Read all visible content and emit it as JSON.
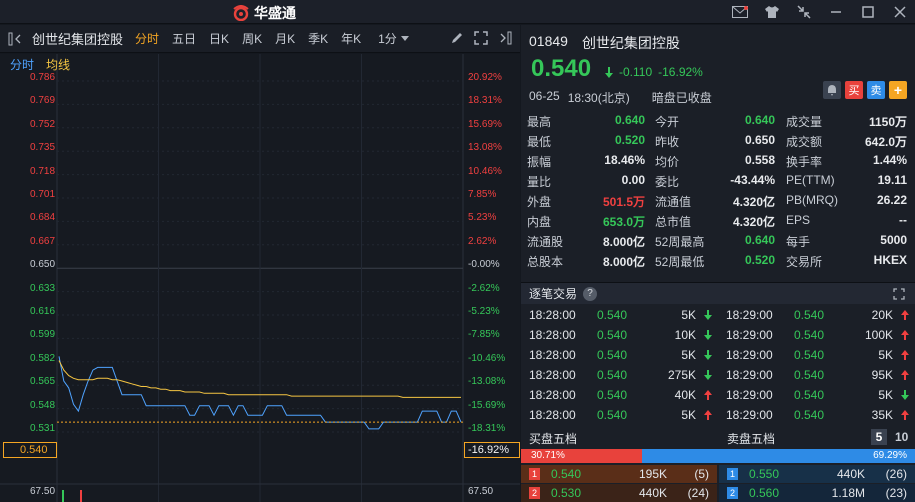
{
  "app": {
    "name": "华盛通"
  },
  "toolbar": {
    "stock_name": "创世纪集团控股",
    "tabs": [
      "分时",
      "五日",
      "日K",
      "周K",
      "月K",
      "季K",
      "年K"
    ],
    "period": "1分"
  },
  "chart": {
    "legend": {
      "timeshare": "分时",
      "avg": "均线"
    },
    "price_labels": [
      "0.786",
      "0.769",
      "0.752",
      "0.735",
      "0.718",
      "0.701",
      "0.684",
      "0.667",
      "0.650",
      "0.633",
      "0.616",
      "0.599",
      "0.582",
      "0.565",
      "0.548",
      "0.531"
    ],
    "pct_labels": [
      "20.92%",
      "18.31%",
      "15.69%",
      "13.08%",
      "10.46%",
      "7.85%",
      "5.23%",
      "2.62%",
      "-0.00%",
      "-2.62%",
      "-5.23%",
      "-7.85%",
      "-10.46%",
      "-13.08%",
      "-15.69%",
      "-18.31%"
    ],
    "current_price": "0.540",
    "current_pct": "-16.92%",
    "volume_label_left": "67.50",
    "volume_label_right": "67.50",
    "colors": {
      "up": "#f04040",
      "down": "#35c759",
      "price_line": "#4fa3ff",
      "avg_line": "#f5c542",
      "accent": "#f5a623"
    }
  },
  "chart_data": {
    "type": "line",
    "title": "",
    "xlabel": "",
    "ylabel": "",
    "ylim": [
      0.5225,
      0.7945
    ],
    "series": [
      {
        "name": "分时",
        "values": [
          0.588,
          0.57,
          0.565,
          0.553,
          0.548,
          0.56,
          0.57,
          0.578,
          0.58,
          0.58,
          0.58,
          0.58,
          0.57,
          0.56,
          0.56,
          0.56,
          0.56,
          0.56,
          0.552,
          0.552,
          0.552,
          0.552,
          0.552,
          0.552,
          0.552,
          0.552,
          0.552,
          0.545,
          0.545,
          0.552,
          0.552,
          0.552,
          0.545,
          0.552,
          0.552,
          0.552,
          0.545,
          0.552,
          0.552,
          0.545,
          0.545,
          0.545,
          0.545,
          0.552,
          0.552,
          0.552,
          0.552,
          0.545,
          0.545,
          0.545,
          0.545,
          0.545,
          0.545,
          0.545,
          0.545,
          0.54,
          0.54,
          0.54,
          0.54,
          0.54,
          0.54,
          0.54,
          0.54,
          0.54,
          0.535,
          0.535,
          0.535,
          0.54,
          0.54,
          0.54,
          0.54,
          0.54,
          0.54,
          0.54,
          0.54,
          0.548,
          0.548,
          0.548,
          0.548,
          0.54,
          0.54,
          0.548,
          0.548,
          0.54
        ]
      },
      {
        "name": "均线",
        "values": [
          0.585,
          0.578,
          0.574,
          0.572,
          0.571,
          0.571,
          0.571,
          0.571,
          0.572,
          0.572,
          0.572,
          0.571,
          0.571,
          0.57,
          0.569,
          0.568,
          0.567,
          0.566,
          0.566,
          0.565,
          0.565,
          0.564,
          0.564,
          0.563,
          0.563,
          0.563,
          0.562,
          0.562,
          0.562,
          0.562,
          0.561,
          0.561,
          0.561,
          0.561,
          0.561,
          0.56,
          0.56,
          0.56,
          0.56,
          0.56,
          0.56,
          0.56,
          0.56,
          0.56,
          0.56,
          0.56,
          0.56,
          0.56,
          0.559,
          0.559,
          0.559,
          0.559,
          0.559,
          0.559,
          0.559,
          0.559,
          0.559,
          0.559,
          0.559,
          0.559,
          0.559,
          0.559,
          0.559,
          0.559,
          0.559,
          0.559,
          0.559,
          0.559,
          0.559,
          0.559,
          0.559,
          0.558,
          0.558,
          0.558,
          0.558,
          0.558,
          0.558,
          0.558,
          0.558,
          0.558,
          0.558,
          0.558,
          0.558,
          0.558
        ]
      }
    ]
  },
  "quote": {
    "code": "01849",
    "name": "创世纪集团控股",
    "price": "0.540",
    "change": "-0.110",
    "change_pct": "-16.92%",
    "date": "06-25",
    "time": "18:30(北京)",
    "status": "暗盘已收盘",
    "btn_buy": "买",
    "btn_sell": "卖",
    "btn_add": "+"
  },
  "stats": [
    [
      {
        "k": "最高",
        "v": "0.640",
        "c": "#35c759"
      },
      {
        "k": "今开",
        "v": "0.640",
        "c": "#35c759"
      },
      {
        "k": "成交量",
        "v": "1150万",
        "c": "#e8eaed"
      }
    ],
    [
      {
        "k": "最低",
        "v": "0.520",
        "c": "#35c759"
      },
      {
        "k": "昨收",
        "v": "0.650",
        "c": "#e8eaed"
      },
      {
        "k": "成交额",
        "v": "642.0万",
        "c": "#e8eaed"
      }
    ],
    [
      {
        "k": "振幅",
        "v": "18.46%",
        "c": "#e8eaed"
      },
      {
        "k": "均价",
        "v": "0.558",
        "c": "#e8eaed"
      },
      {
        "k": "换手率",
        "v": "1.44%",
        "c": "#e8eaed"
      }
    ],
    [
      {
        "k": "量比",
        "v": "0.00",
        "c": "#e8eaed"
      },
      {
        "k": "委比",
        "v": "-43.44%",
        "c": "#e8eaed"
      },
      {
        "k": "PE(TTM)",
        "v": "19.11",
        "c": "#e8eaed"
      }
    ],
    [
      {
        "k": "外盘",
        "v": "501.5万",
        "c": "#f04040"
      },
      {
        "k": "流通值",
        "v": "4.320亿",
        "c": "#e8eaed"
      },
      {
        "k": "PB(MRQ)",
        "v": "26.22",
        "c": "#e8eaed"
      }
    ],
    [
      {
        "k": "内盘",
        "v": "653.0万",
        "c": "#35c759"
      },
      {
        "k": "总市值",
        "v": "4.320亿",
        "c": "#e8eaed"
      },
      {
        "k": "EPS",
        "v": "--",
        "c": "#e8eaed"
      }
    ],
    [
      {
        "k": "流通股",
        "v": "8.000亿",
        "c": "#e8eaed"
      },
      {
        "k": "52周最高",
        "v": "0.640",
        "c": "#35c759"
      },
      {
        "k": "每手",
        "v": "5000",
        "c": "#e8eaed"
      }
    ],
    [
      {
        "k": "总股本",
        "v": "8.000亿",
        "c": "#e8eaed"
      },
      {
        "k": "52周最低",
        "v": "0.520",
        "c": "#35c759"
      },
      {
        "k": "交易所",
        "v": "HKEX",
        "c": "#e8eaed"
      }
    ]
  ],
  "trades": {
    "title": "逐笔交易",
    "help": "?",
    "left": [
      {
        "t": "18:28:00",
        "p": "0.540",
        "v": "5K",
        "dir": "down"
      },
      {
        "t": "18:28:00",
        "p": "0.540",
        "v": "10K",
        "dir": "down"
      },
      {
        "t": "18:28:00",
        "p": "0.540",
        "v": "5K",
        "dir": "down"
      },
      {
        "t": "18:28:00",
        "p": "0.540",
        "v": "275K",
        "dir": "down"
      },
      {
        "t": "18:28:00",
        "p": "0.540",
        "v": "40K",
        "dir": "up"
      },
      {
        "t": "18:28:00",
        "p": "0.540",
        "v": "5K",
        "dir": "up"
      }
    ],
    "right": [
      {
        "t": "18:29:00",
        "p": "0.540",
        "v": "20K",
        "dir": "up"
      },
      {
        "t": "18:29:00",
        "p": "0.540",
        "v": "100K",
        "dir": "up"
      },
      {
        "t": "18:29:00",
        "p": "0.540",
        "v": "5K",
        "dir": "up"
      },
      {
        "t": "18:29:00",
        "p": "0.540",
        "v": "95K",
        "dir": "up"
      },
      {
        "t": "18:29:00",
        "p": "0.540",
        "v": "5K",
        "dir": "down"
      },
      {
        "t": "18:29:00",
        "p": "0.540",
        "v": "35K",
        "dir": "up"
      }
    ]
  },
  "orderbook": {
    "bid_title": "买盘五档",
    "ask_title": "卖盘五档",
    "depth_5": "5",
    "depth_10": "10",
    "bid_pct": "30.71%",
    "ask_pct": "69.29%",
    "bid_ratio": 0.3071,
    "bids": [
      {
        "lvl": "1",
        "p": "0.540",
        "v": "195K",
        "n": "(5)"
      },
      {
        "lvl": "2",
        "p": "0.530",
        "v": "440K",
        "n": "(24)"
      }
    ],
    "asks": [
      {
        "lvl": "1",
        "p": "0.550",
        "v": "440K",
        "n": "(26)"
      },
      {
        "lvl": "2",
        "p": "0.560",
        "v": "1.18M",
        "n": "(23)"
      }
    ]
  }
}
